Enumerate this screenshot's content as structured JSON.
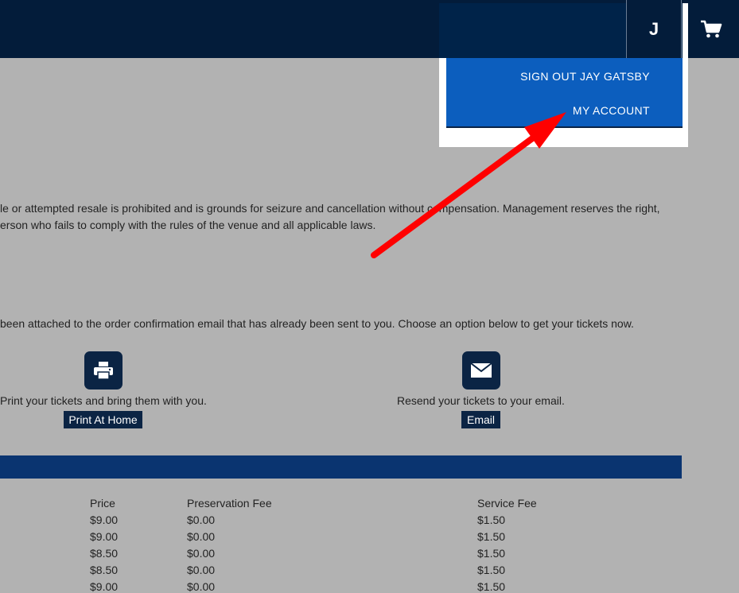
{
  "header": {
    "avatar_initial": "J",
    "user_menu": {
      "sign_out_label": "SIGN OUT JAY GATSBY",
      "my_account_label": "MY ACCOUNT"
    }
  },
  "content": {
    "policy_line_1": "le or attempted resale is prohibited and is grounds for seizure and cancellation without compensation. Management reserves the right,",
    "policy_line_2": "erson who fails to comply with the rules of the venue and all applicable laws.",
    "attach_text": "been attached to the order confirmation email that has already been sent to you.  Choose an option below to get your tickets now.",
    "options": [
      {
        "text": "Print your tickets and bring them with you.",
        "button": "Print At Home"
      },
      {
        "text": "Resend your tickets to your email.",
        "button": "Email"
      }
    ]
  },
  "fees_table": {
    "headers": [
      "Price",
      "Preservation Fee",
      "Service Fee"
    ],
    "rows": [
      [
        "$9.00",
        "$0.00",
        "$1.50"
      ],
      [
        "$9.00",
        "$0.00",
        "$1.50"
      ],
      [
        "$8.50",
        "$0.00",
        "$1.50"
      ],
      [
        "$8.50",
        "$0.00",
        "$1.50"
      ],
      [
        "$9.00",
        "$0.00",
        "$1.50"
      ]
    ]
  },
  "colors": {
    "navbar": "#031c3a",
    "dropdown": "#0c5ebe",
    "band": "#0a3470",
    "overlay": "#b2b2b2",
    "annotation_arrow": "#ff0000"
  }
}
